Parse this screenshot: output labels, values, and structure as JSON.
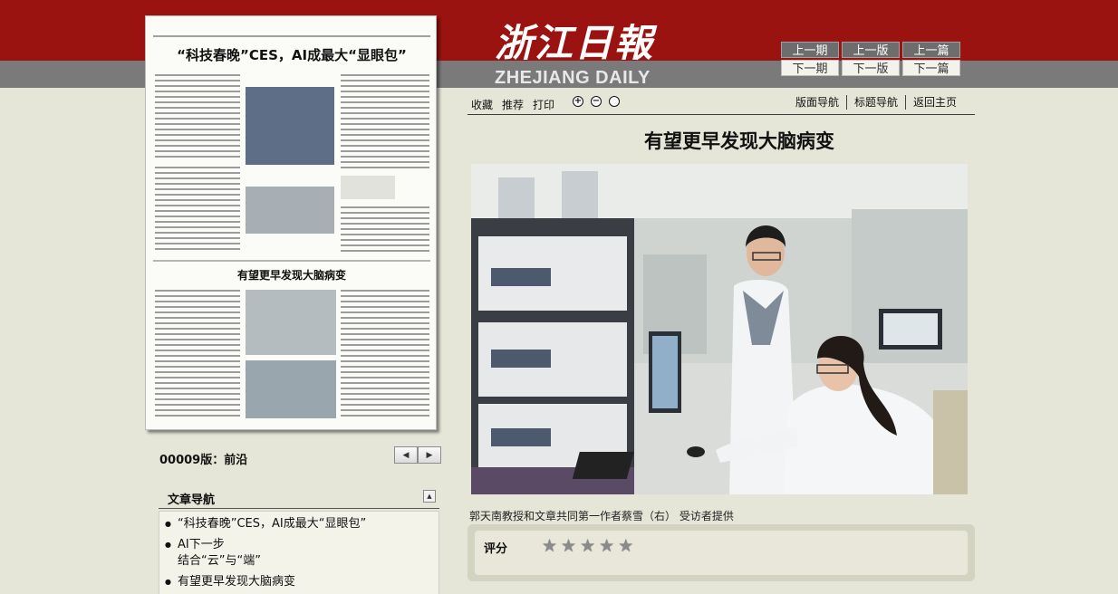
{
  "masthead": {
    "cn": "浙江日報",
    "en": "ZHEJIANG DAILY"
  },
  "page_nav": {
    "prev_period": "上一期",
    "prev_edition": "上一版",
    "prev_article": "上一篇",
    "next_period": "下一期",
    "next_edition": "下一版",
    "next_article": "下一篇"
  },
  "tools": {
    "collect": "收藏",
    "recommend": "推荐",
    "print": "打印"
  },
  "zoom": {
    "in": "+",
    "out": "−",
    "reset": ""
  },
  "right_nav": {
    "layout_nav": "版面导航",
    "title_nav": "标题导航",
    "home": "返回主页"
  },
  "article": {
    "title": "有望更早发现大脑病变",
    "caption": "郭天南教授和文章共同第一作者蔡雪（右） 受访者提供"
  },
  "rating": {
    "label": "评分",
    "stars": [
      "★",
      "★",
      "★",
      "★",
      "★"
    ]
  },
  "thumbnail": {
    "headline": "“科技春晚”CES，AI成最大“显眼包”",
    "subhead": "有望更早发现大脑病变"
  },
  "edition": {
    "label": "00009版：前沿",
    "prev_icon": "◀",
    "next_icon": "▶"
  },
  "article_nav": {
    "title": "文章导航",
    "toggle_icon": "▲",
    "items": [
      {
        "line1": "“科技春晚”CES，AI成最大“显眼包”",
        "line2": ""
      },
      {
        "line1": "AI下一步",
        "line2": "结合“云”与“端”"
      },
      {
        "line1": "有望更早发现大脑病变",
        "line2": ""
      }
    ]
  },
  "colors": {
    "header_red": "#9b1311",
    "header_gray": "#7a7a7a",
    "page_bg": "#e6e6d8"
  }
}
